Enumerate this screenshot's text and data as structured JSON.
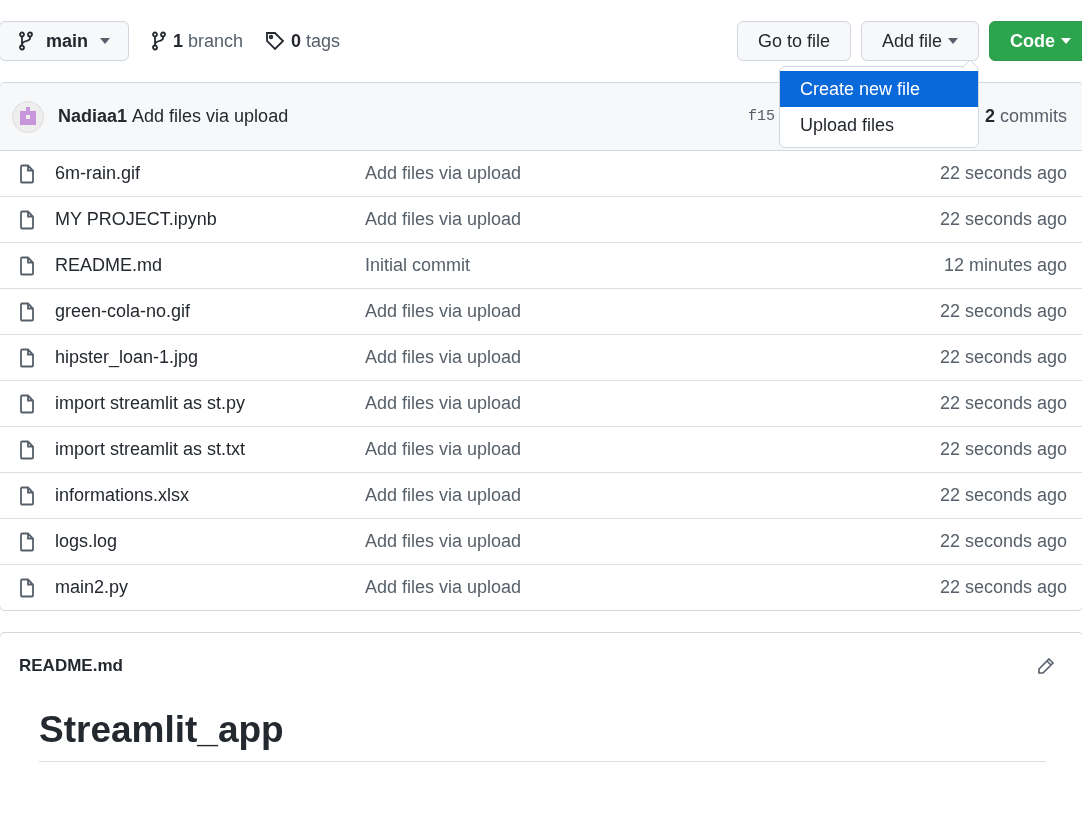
{
  "toolbar": {
    "branch_button": "main",
    "branches": "**1** branch",
    "tags": "**0** tags",
    "buttons": [
      {
        "label": "Go to file",
        "kind": "plain"
      },
      {
        "label": "Add file",
        "kind": "menu"
      },
      {
        "label": "Code",
        "kind": "primary"
      }
    ]
  },
  "add_file_menu": {
    "items": [
      {
        "label": "Create new file",
        "selected": true
      },
      {
        "label": "Upload files",
        "selected": false
      }
    ]
  },
  "commit": {
    "author": "Nadiaa1",
    "message": "Add files via upload",
    "hash": "f15",
    "commits": "**2** commits"
  },
  "files": [
    {
      "name": "6m-rain.gif",
      "message": "Add files via upload",
      "age": "22 seconds ago"
    },
    {
      "name": "MY PROJECT.ipynb",
      "message": "Add files via upload",
      "age": "22 seconds ago"
    },
    {
      "name": "README.md",
      "message": "Initial commit",
      "age": "12 minutes ago"
    },
    {
      "name": "green-cola-no.gif",
      "message": "Add files via upload",
      "age": "22 seconds ago"
    },
    {
      "name": "hipster_loan-1.jpg",
      "message": "Add files via upload",
      "age": "22 seconds ago"
    },
    {
      "name": "import streamlit as st.py",
      "message": "Add files via upload",
      "age": "22 seconds ago"
    },
    {
      "name": "import streamlit as st.txt",
      "message": "Add files via upload",
      "age": "22 seconds ago"
    },
    {
      "name": "informations.xlsx",
      "message": "Add files via upload",
      "age": "22 seconds ago"
    },
    {
      "name": "logs.log",
      "message": "Add files via upload",
      "age": "22 seconds ago"
    },
    {
      "name": "main2.py",
      "message": "Add files via upload",
      "age": "22 seconds ago"
    }
  ],
  "readme": {
    "file_name": "README.md",
    "heading": "Streamlit_app"
  }
}
